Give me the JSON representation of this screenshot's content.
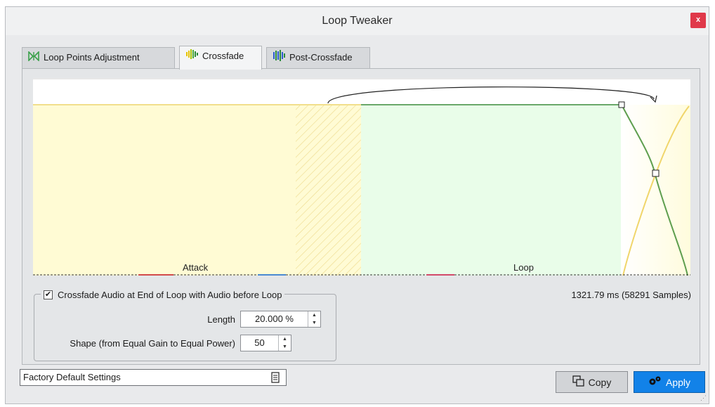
{
  "window": {
    "title": "Loop Tweaker",
    "close_glyph": "x"
  },
  "tabs": [
    {
      "label": "Loop Points Adjustment",
      "icon": "loop-points-icon",
      "active": false
    },
    {
      "label": "Crossfade",
      "icon": "crossfade-icon",
      "active": true
    },
    {
      "label": "Post-Crossfade",
      "icon": "post-crossfade-icon",
      "active": false
    }
  ],
  "graph": {
    "attack_label": "Attack",
    "loop_label": "Loop",
    "colors": {
      "attack": "#fffbd4",
      "loop": "#e9fde9",
      "attack_line": "#f4e48a",
      "loop_line": "#6aa86a"
    }
  },
  "options": {
    "crossfade_checked": true,
    "crossfade_label": "Crossfade Audio at End of Loop with Audio before Loop",
    "length_label": "Length",
    "length_value": "20.000 %",
    "shape_label": "Shape (from Equal Gain to Equal Power)",
    "shape_value": "50",
    "duration": "1321.79 ms (58291 Samples)"
  },
  "footer": {
    "preset": "Factory Default Settings",
    "copy_label": "Copy",
    "apply_label": "Apply",
    "apply_color": "#1282e8"
  }
}
